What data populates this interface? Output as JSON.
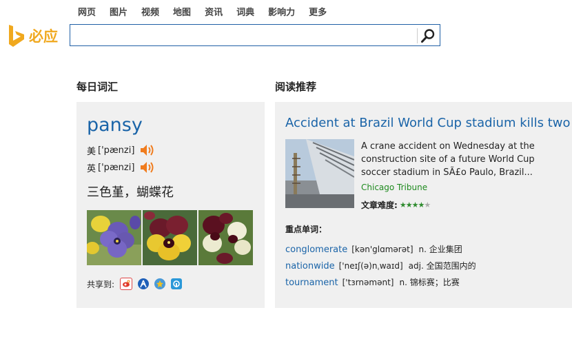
{
  "brand": {
    "logo_text": "必应",
    "accent": "#f0a81e",
    "link_color": "#1a64a8"
  },
  "nav": [
    "网页",
    "图片",
    "视频",
    "地图",
    "资讯",
    "词典",
    "影响力",
    "更多"
  ],
  "search": {
    "value": "",
    "placeholder": ""
  },
  "daily_word": {
    "section_title": "每日词汇",
    "word": "pansy",
    "us_label": "美",
    "us_phonetic": "['pænzi]",
    "uk_label": "英",
    "uk_phonetic": "['pænzi]",
    "meaning": "三色堇，蝴蝶花",
    "share_label": "共享到:",
    "share_icons": [
      "weibo-icon",
      "renren-icon",
      "qzone-icon",
      "pengyou-icon"
    ]
  },
  "reading": {
    "section_title": "阅读推荐",
    "title": "Accident at Brazil World Cup stadium kills two",
    "summary": "A crane accident on Wednesday at the construction site of a future World Cup soccer stadium in SÃ£o Paulo, Brazil...",
    "source": "Chicago Tribune",
    "difficulty_label": "文章难度:",
    "difficulty_rating": 4,
    "difficulty_max": 5,
    "keywords_title": "重点单词：",
    "keywords": [
      {
        "en": "conglomerate",
        "ph": "[kən'glɑmərət]",
        "cn": "n. 企业集团"
      },
      {
        "en": "nationwide",
        "ph": "['neɪʃ(ə)nˌwaɪd]",
        "cn": "adj. 全国范围内的"
      },
      {
        "en": "tournament",
        "ph": "['tɜrnəmənt]",
        "cn": "n. 锦标赛；比赛"
      }
    ]
  }
}
